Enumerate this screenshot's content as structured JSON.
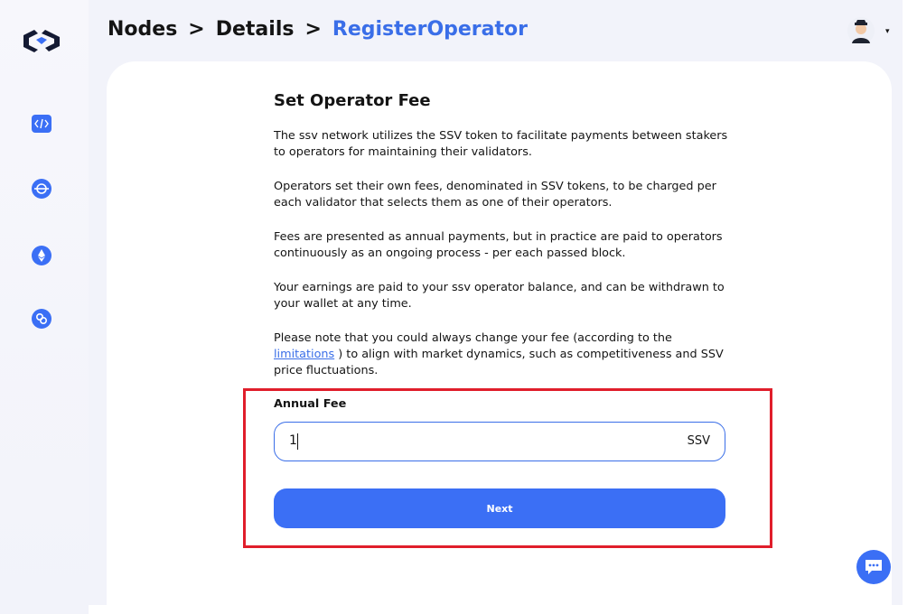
{
  "breadcrumb": {
    "items": [
      "Nodes",
      "Details"
    ],
    "current": "RegisterOperator",
    "separator": ">"
  },
  "sidebar": {
    "items": [
      {
        "icon": "code-icon"
      },
      {
        "icon": "node-icon"
      },
      {
        "icon": "ethereum-icon"
      },
      {
        "icon": "link-icon"
      }
    ]
  },
  "user": {
    "avatar": "avatar",
    "menu_caret": "▾"
  },
  "page": {
    "title": "Set Operator Fee",
    "paragraphs": [
      "The ssv network utilizes the SSV token to facilitate payments between stakers to operators for maintaining their validators.",
      "Operators set their own fees, denominated in SSV tokens, to be charged per each validator that selects them as one of their operators.",
      "Fees are presented as annual payments, but in practice are paid to operators continuously as an ongoing process - per each passed block.",
      "Your earnings are paid to your ssv operator balance, and can be withdrawn to your wallet at any time."
    ],
    "note_before_link": "Please note that you could always change your fee (according to the ",
    "note_link": "limitations",
    "note_after_link": " ) to align with market dynamics, such as competitiveness and SSV price fluctuations."
  },
  "form": {
    "fee_label": "Annual Fee",
    "fee_value": "1",
    "fee_unit": "SSV",
    "next_label": "Next"
  },
  "colors": {
    "accent": "#3b6ff5",
    "highlight": "#e01e2b"
  }
}
